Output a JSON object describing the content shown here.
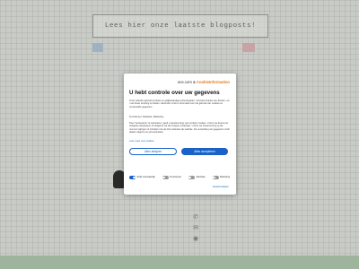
{
  "page": {
    "banner_text": "Lees hier onze laatste blogposts!"
  },
  "contact": {
    "icons": [
      "phone-icon",
      "mail-icon",
      "location-icon"
    ]
  },
  "consent": {
    "brand_name": "one.com",
    "brand_separator": "&",
    "brand_partner": "CookieInformation",
    "title": "U hebt controle over uw gegevens",
    "intro": "Onze website gebruikt cookies en gelijkwaardige technologieën, inclusief cookies van derden, om u de beste ervaring te bieden. Hieronder vindt u informatie over het gebruik van cookies en verzamelde gegevens.",
    "categories_line": "Functioneel, Statistiek, Marketing",
    "body": "Door 'Accepteren' te selecteren, geeft u toestemming voor al deze cookies. U kunt uw keuze per categorie aanpassen of weigeren via de knoppen onderaan. U kunt uw toestemming op elk moment wijzigen of intrekken via de link onderaan de website. De verwerking van gegevens vindt plaats volgens ons privacybeleid.",
    "more_link": "Lees meer over cookies",
    "deny_label": "Alles afwijzen",
    "accept_label": "Alles accepteren",
    "toggles": [
      {
        "label": "Strikt noodzakelijk",
        "state": "on"
      },
      {
        "label": "Functioneel",
        "state": "off"
      },
      {
        "label": "Statistiek",
        "state": "off"
      },
      {
        "label": "Marketing",
        "state": "off"
      }
    ],
    "details_link": "Details bekijken"
  },
  "colors": {
    "accent": "#1a62c7",
    "brand_partner": "#e07b1f",
    "footer": "#9fb49d"
  }
}
